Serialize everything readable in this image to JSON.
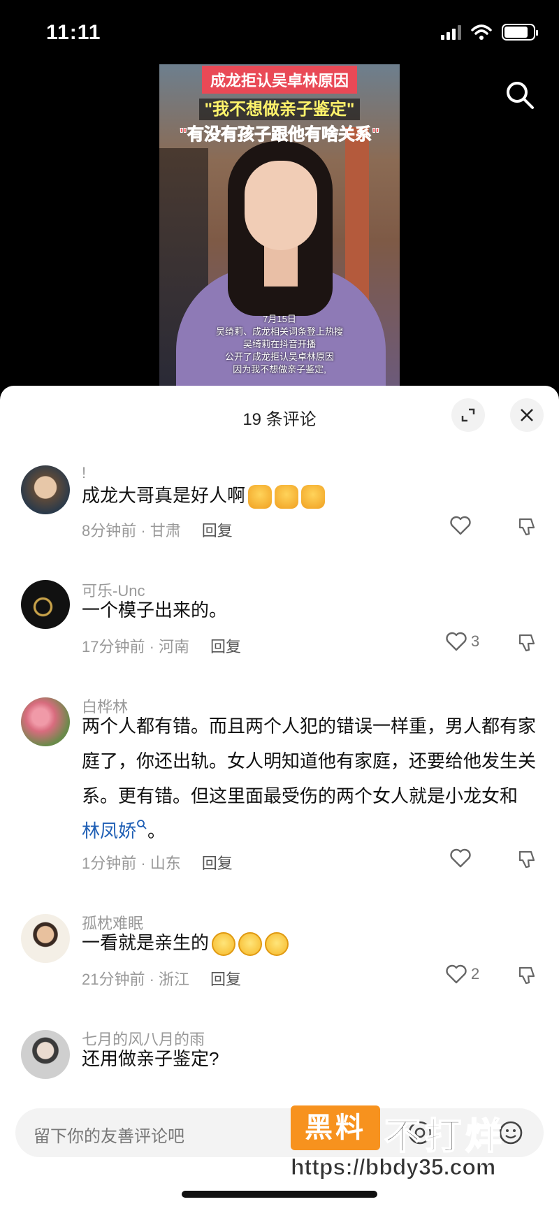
{
  "status_bar": {
    "time": "11:11"
  },
  "video": {
    "caption_title": "成龙拒认吴卓林原因",
    "caption_quote1": "\"我不想做亲子鉴定\"",
    "caption_quote2": "\"有没有孩子跟他有啥关系\"",
    "overlay_lines": [
      "7月15日",
      "吴绮莉、成龙相关词条登上热搜",
      "吴绮莉在抖音开播",
      "公开了成龙拒认吴卓林原因",
      "因为我不想做亲子鉴定,"
    ]
  },
  "comments_panel": {
    "title": "19 条评论",
    "comments": [
      {
        "user": "!",
        "text": "成龙大哥真是好人啊",
        "time_location": "8分钟前 · 甘肃",
        "reply": "回复",
        "likes": ""
      },
      {
        "user": "可乐-Unc",
        "text": "一个模子出来的。",
        "time_location": "17分钟前 · 河南",
        "reply": "回复",
        "likes": "3"
      },
      {
        "user": "白桦林",
        "text": "两个人都有错。而且两个人犯的错误一样重，男人都有家庭了，你还出轨。女人明知道他有家庭，还要给他发生关系。更有错。但这里面最受伤的两个女人就是小龙女和",
        "link": "林凤娇",
        "text_end": "。",
        "time_location": "1分钟前 · 山东",
        "reply": "回复",
        "likes": ""
      },
      {
        "user": "孤枕难眠",
        "text": "一看就是亲生的",
        "time_location": "21分钟前 · 浙江",
        "reply": "回复",
        "likes": "2"
      },
      {
        "user": "七月的风八月的雨",
        "text": "还用做亲子鉴定?",
        "time_location": "",
        "reply": "",
        "likes": ""
      }
    ]
  },
  "input": {
    "placeholder": "留下你的友善评论吧"
  },
  "watermark": {
    "box_text": "黑料",
    "big_text": "不打烊",
    "url": "https://bbdy35.com"
  },
  "colors": {
    "link": "#1f5fb5",
    "watermark_orange": "#f7921e"
  }
}
